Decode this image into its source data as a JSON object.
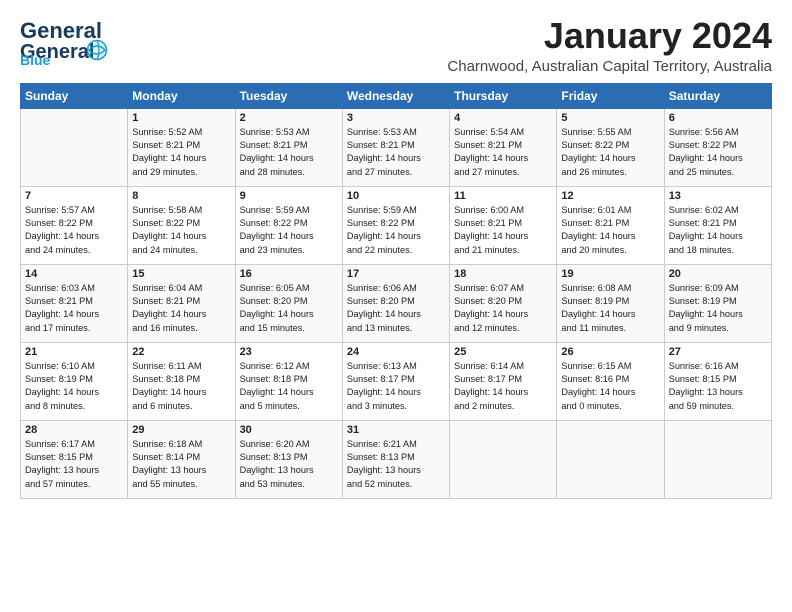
{
  "header": {
    "logo_general": "General",
    "logo_blue": "Blue",
    "month": "January 2024",
    "location": "Charnwood, Australian Capital Territory, Australia"
  },
  "days_of_week": [
    "Sunday",
    "Monday",
    "Tuesday",
    "Wednesday",
    "Thursday",
    "Friday",
    "Saturday"
  ],
  "weeks": [
    [
      {
        "num": "",
        "info": ""
      },
      {
        "num": "1",
        "info": "Sunrise: 5:52 AM\nSunset: 8:21 PM\nDaylight: 14 hours\nand 29 minutes."
      },
      {
        "num": "2",
        "info": "Sunrise: 5:53 AM\nSunset: 8:21 PM\nDaylight: 14 hours\nand 28 minutes."
      },
      {
        "num": "3",
        "info": "Sunrise: 5:53 AM\nSunset: 8:21 PM\nDaylight: 14 hours\nand 27 minutes."
      },
      {
        "num": "4",
        "info": "Sunrise: 5:54 AM\nSunset: 8:21 PM\nDaylight: 14 hours\nand 27 minutes."
      },
      {
        "num": "5",
        "info": "Sunrise: 5:55 AM\nSunset: 8:22 PM\nDaylight: 14 hours\nand 26 minutes."
      },
      {
        "num": "6",
        "info": "Sunrise: 5:56 AM\nSunset: 8:22 PM\nDaylight: 14 hours\nand 25 minutes."
      }
    ],
    [
      {
        "num": "7",
        "info": "Sunrise: 5:57 AM\nSunset: 8:22 PM\nDaylight: 14 hours\nand 24 minutes."
      },
      {
        "num": "8",
        "info": "Sunrise: 5:58 AM\nSunset: 8:22 PM\nDaylight: 14 hours\nand 24 minutes."
      },
      {
        "num": "9",
        "info": "Sunrise: 5:59 AM\nSunset: 8:22 PM\nDaylight: 14 hours\nand 23 minutes."
      },
      {
        "num": "10",
        "info": "Sunrise: 5:59 AM\nSunset: 8:22 PM\nDaylight: 14 hours\nand 22 minutes."
      },
      {
        "num": "11",
        "info": "Sunrise: 6:00 AM\nSunset: 8:21 PM\nDaylight: 14 hours\nand 21 minutes."
      },
      {
        "num": "12",
        "info": "Sunrise: 6:01 AM\nSunset: 8:21 PM\nDaylight: 14 hours\nand 20 minutes."
      },
      {
        "num": "13",
        "info": "Sunrise: 6:02 AM\nSunset: 8:21 PM\nDaylight: 14 hours\nand 18 minutes."
      }
    ],
    [
      {
        "num": "14",
        "info": "Sunrise: 6:03 AM\nSunset: 8:21 PM\nDaylight: 14 hours\nand 17 minutes."
      },
      {
        "num": "15",
        "info": "Sunrise: 6:04 AM\nSunset: 8:21 PM\nDaylight: 14 hours\nand 16 minutes."
      },
      {
        "num": "16",
        "info": "Sunrise: 6:05 AM\nSunset: 8:20 PM\nDaylight: 14 hours\nand 15 minutes."
      },
      {
        "num": "17",
        "info": "Sunrise: 6:06 AM\nSunset: 8:20 PM\nDaylight: 14 hours\nand 13 minutes."
      },
      {
        "num": "18",
        "info": "Sunrise: 6:07 AM\nSunset: 8:20 PM\nDaylight: 14 hours\nand 12 minutes."
      },
      {
        "num": "19",
        "info": "Sunrise: 6:08 AM\nSunset: 8:19 PM\nDaylight: 14 hours\nand 11 minutes."
      },
      {
        "num": "20",
        "info": "Sunrise: 6:09 AM\nSunset: 8:19 PM\nDaylight: 14 hours\nand 9 minutes."
      }
    ],
    [
      {
        "num": "21",
        "info": "Sunrise: 6:10 AM\nSunset: 8:19 PM\nDaylight: 14 hours\nand 8 minutes."
      },
      {
        "num": "22",
        "info": "Sunrise: 6:11 AM\nSunset: 8:18 PM\nDaylight: 14 hours\nand 6 minutes."
      },
      {
        "num": "23",
        "info": "Sunrise: 6:12 AM\nSunset: 8:18 PM\nDaylight: 14 hours\nand 5 minutes."
      },
      {
        "num": "24",
        "info": "Sunrise: 6:13 AM\nSunset: 8:17 PM\nDaylight: 14 hours\nand 3 minutes."
      },
      {
        "num": "25",
        "info": "Sunrise: 6:14 AM\nSunset: 8:17 PM\nDaylight: 14 hours\nand 2 minutes."
      },
      {
        "num": "26",
        "info": "Sunrise: 6:15 AM\nSunset: 8:16 PM\nDaylight: 14 hours\nand 0 minutes."
      },
      {
        "num": "27",
        "info": "Sunrise: 6:16 AM\nSunset: 8:15 PM\nDaylight: 13 hours\nand 59 minutes."
      }
    ],
    [
      {
        "num": "28",
        "info": "Sunrise: 6:17 AM\nSunset: 8:15 PM\nDaylight: 13 hours\nand 57 minutes."
      },
      {
        "num": "29",
        "info": "Sunrise: 6:18 AM\nSunset: 8:14 PM\nDaylight: 13 hours\nand 55 minutes."
      },
      {
        "num": "30",
        "info": "Sunrise: 6:20 AM\nSunset: 8:13 PM\nDaylight: 13 hours\nand 53 minutes."
      },
      {
        "num": "31",
        "info": "Sunrise: 6:21 AM\nSunset: 8:13 PM\nDaylight: 13 hours\nand 52 minutes."
      },
      {
        "num": "",
        "info": ""
      },
      {
        "num": "",
        "info": ""
      },
      {
        "num": "",
        "info": ""
      }
    ]
  ]
}
